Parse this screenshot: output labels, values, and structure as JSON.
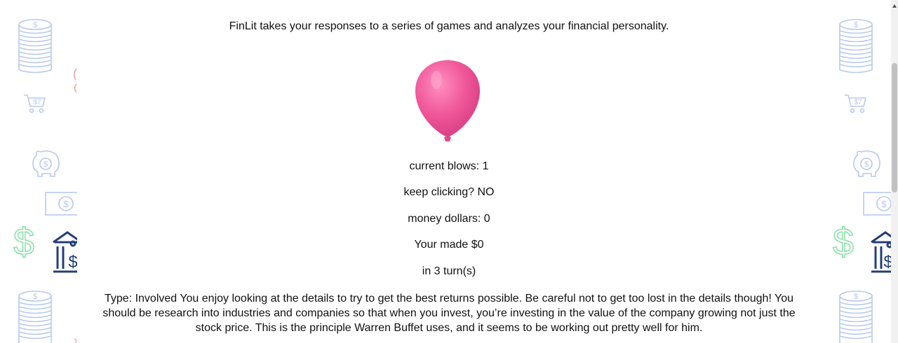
{
  "intro": "FinLit takes your responses to a series of games and analyzes your financial personality.",
  "balloon": {
    "icon": "balloon-icon",
    "color": "#F0589A"
  },
  "stats": {
    "current_blows": "current blows: 1",
    "keep_clicking": "keep clicking? NO",
    "money_dollars": "money dollars: 0",
    "you_made": "Your made $0",
    "turns": "in 3 turn(s)"
  },
  "result": "Type: Involved You enjoy looking at the details to try to get the best returns possible. Be careful not to get too lost in the details though! You should be research into industries and companies so that when you invest, you’re investing in the value of the company growing not just the stock price. This is the principle Warren Buffet uses, and it seems to be working out pretty well for him.",
  "decor": {
    "icons": [
      "coin-stack-icon",
      "shopping-cart-icon",
      "piggy-bank-icon",
      "banknote-icon",
      "dollar-sign-icon",
      "bank-icon"
    ],
    "colors": {
      "coin": "#B8C9EE",
      "dollar": "#7EE0A0",
      "bank": "#243E7A",
      "accent": "#F5A3A3"
    }
  }
}
